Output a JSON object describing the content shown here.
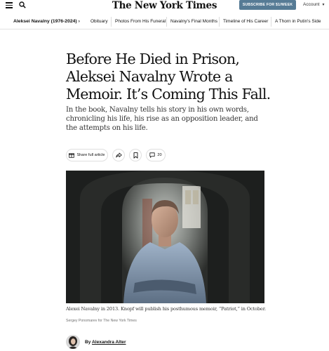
{
  "header": {
    "masthead": "The New York Times",
    "subscribe_label": "SUBSCRIBE FOR $1/WEEK",
    "account_label": "Account",
    "icons": {
      "menu": "hamburger-menu-icon",
      "search": "search-icon",
      "account_chevron": "chevron-down-icon"
    }
  },
  "nav": {
    "current": "Aleksei Navalny (1976-2024)",
    "current_arrow": "›",
    "items": [
      "Obituary",
      "Photos From His Funeral",
      "Navalny's Final Months",
      "Timeline of His Career",
      "A Thorn in Putin's Side"
    ]
  },
  "article": {
    "headline": "Before He Died in Prison, Aleksei Navalny Wrote a Memoir. It’s Coming This Fall.",
    "summary": "In the book, Navalny tells his story in his own words, chronicling his life, his rise as an opposition leader, and the attempts on his life.",
    "share": {
      "label": "Share full article",
      "comment_count": "20"
    },
    "photo": {
      "caption": "Alexei Navalny in 2013. Knopf will publish his posthumous memoir, “Patriot,” in October.",
      "credit": "Sergey Ponomarev for The New York Times"
    },
    "byline": {
      "prefix": "By",
      "author": "Alexandra Alter"
    }
  },
  "colors": {
    "subscribe_bg": "#567b95",
    "text": "#121212",
    "border": "#e2e2e2"
  }
}
